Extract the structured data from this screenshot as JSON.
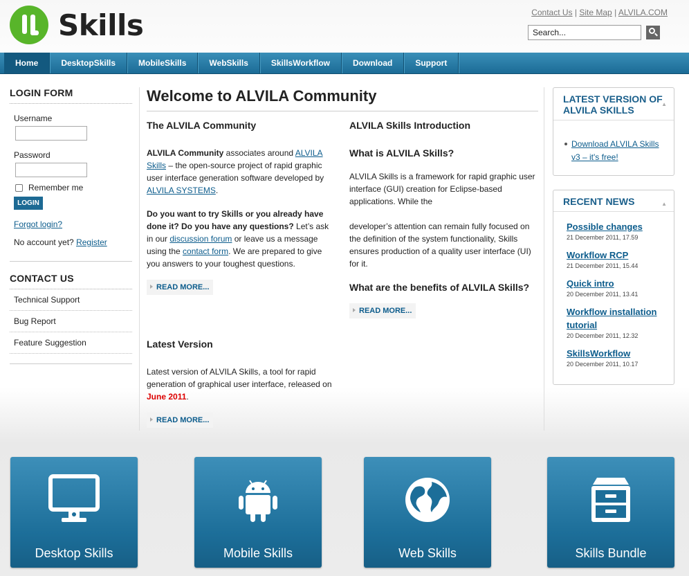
{
  "header": {
    "logo_text": "Skills",
    "toplinks": [
      "Contact Us",
      "Site Map",
      "ALVILA.COM"
    ],
    "toplinks_sep": "|",
    "search_value": "Search..."
  },
  "nav": [
    "Home",
    "DesktopSkills",
    "MobileSkills",
    "WebSkills",
    "SkillsWorkflow",
    "Download",
    "Support"
  ],
  "login": {
    "title": "LOGIN FORM",
    "username_label": "Username",
    "password_label": "Password",
    "remember_label": "Remember me",
    "button": "LOGIN",
    "forgot": "Forgot login?",
    "no_account": "No account yet?",
    "register": "Register"
  },
  "contact": {
    "title": "CONTACT US",
    "items": [
      "Technical Support",
      "Bug Report",
      "Feature Suggestion"
    ]
  },
  "main": {
    "title": "Welcome to ALVILA Community",
    "community": {
      "heading": "The ALVILA Community",
      "p1_bold": "ALVILA Community",
      "p1_a": " associates around ",
      "p1_link": "ALVILA Skills",
      "p1_b": " – the open-source project of rapid graphic user interface generation software developed by ",
      "p1_link2": "ALVILA SYSTEMS",
      "p1_c": ".",
      "p2_bold": "Do you want to try Skills or you already have done it? Do you have any questions?",
      "p2_a": " Let’s ask in our ",
      "p2_link": "discussion forum",
      "p2_b": " or leave us a message using the ",
      "p2_link2": "contact form",
      "p2_c": ". We are prepared to give you answers to your toughest questions.",
      "readmore": "READ MORE..."
    },
    "latest": {
      "heading": "Latest Version",
      "text_a": "Latest version of ALVILA Skills, a tool for rapid generation of graphical user interface, released on ",
      "text_red": "June 2011",
      "text_b": ".",
      "readmore": "READ MORE..."
    },
    "intro": {
      "heading": "ALVILA Skills Introduction",
      "sub1": "What is ALVILA Skills?",
      "p1": "ALVILA Skills is a framework for rapid graphic user interface (GUI) creation for Eclipse-based applications. While the",
      "p2": "developer’s attention can remain fully focused on the definition of the system functionality, Skills ensures production of a quality user interface (UI) for it.",
      "sub2": "What are the benefits of ALVILA Skills?",
      "readmore": "READ MORE..."
    }
  },
  "right": {
    "latest_title": "LATEST VERSION OF ALVILA SKILLS",
    "latest_link": "Download ALVILA Skills v3 – it's free!",
    "news_title": "RECENT NEWS",
    "news": [
      {
        "title": "Possible changes",
        "date": "21 December 2011, 17.59"
      },
      {
        "title": "Workflow RCP",
        "date": "21 December 2011, 15.44"
      },
      {
        "title": "Quick intro",
        "date": "20 December 2011, 13.41"
      },
      {
        "title": "Workflow installation tutorial",
        "date": "20 December 2011, 12.32"
      },
      {
        "title": "SkillsWorkflow",
        "date": "20 December 2011, 10.17"
      }
    ]
  },
  "tiles": [
    {
      "label": "Desktop Skills",
      "icon": "desktop-icon"
    },
    {
      "label": "Mobile Skills",
      "icon": "android-icon"
    },
    {
      "label": "Web Skills",
      "icon": "globe-icon"
    },
    {
      "label": "Skills Bundle",
      "icon": "cabinet-icon"
    }
  ]
}
